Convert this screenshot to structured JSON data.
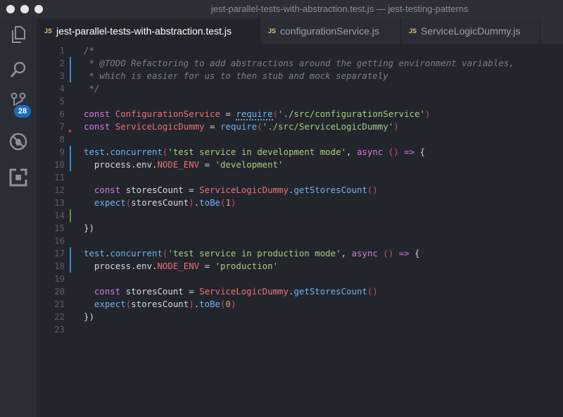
{
  "window": {
    "title": "jest-parallel-tests-with-abstraction.test.js — jest-testing-patterns"
  },
  "activity_bar": {
    "items": [
      {
        "name": "explorer-icon"
      },
      {
        "name": "search-icon"
      },
      {
        "name": "source-control-icon",
        "badge": "28"
      },
      {
        "name": "debug-icon"
      },
      {
        "name": "extensions-icon"
      }
    ]
  },
  "tabs": [
    {
      "icon": "JS",
      "label": "jest-parallel-tests-with-abstraction.test.js",
      "active": true
    },
    {
      "icon": "JS",
      "label": "configurationService.js",
      "active": false
    },
    {
      "icon": "JS",
      "label": "ServiceLogicDummy.js",
      "active": false
    }
  ],
  "editor": {
    "lines": [
      {
        "n": "1",
        "gutter": "",
        "tokens": [
          [
            "cm",
            "/*"
          ]
        ]
      },
      {
        "n": "2",
        "gutter": "mod",
        "tokens": [
          [
            "cm",
            " * @TODO Refactoring to add abstractions around the getting environment variables,"
          ]
        ]
      },
      {
        "n": "3",
        "gutter": "mod",
        "tokens": [
          [
            "cm",
            " * which is easier for us to then stub and mock separately"
          ]
        ]
      },
      {
        "n": "4",
        "gutter": "",
        "tokens": [
          [
            "cm",
            " */"
          ]
        ]
      },
      {
        "n": "5",
        "gutter": "",
        "tokens": []
      },
      {
        "n": "6",
        "gutter": "",
        "tokens": [
          [
            "kw",
            "const "
          ],
          [
            "cls",
            "ConfigurationService"
          ],
          [
            "txt",
            " = "
          ],
          [
            "fn",
            "require"
          ],
          [
            "par",
            "("
          ],
          [
            "str",
            "'./src/configurationService'"
          ],
          [
            "par",
            ")"
          ]
        ]
      },
      {
        "n": "7",
        "gutter": "del",
        "tokens": [
          [
            "kw",
            "const "
          ],
          [
            "cls",
            "ServiceLogicDummy"
          ],
          [
            "txt",
            " = "
          ],
          [
            "fn",
            "require"
          ],
          [
            "par",
            "("
          ],
          [
            "str",
            "'./src/ServiceLogicDummy'"
          ],
          [
            "par",
            ")"
          ]
        ]
      },
      {
        "n": "8",
        "gutter": "",
        "tokens": []
      },
      {
        "n": "9",
        "gutter": "mod",
        "tokens": [
          [
            "fn",
            "test"
          ],
          [
            "txt",
            "."
          ],
          [
            "fn",
            "concurrent"
          ],
          [
            "par",
            "("
          ],
          [
            "str",
            "'test service in development mode'"
          ],
          [
            "txt",
            ", "
          ],
          [
            "kw",
            "async "
          ],
          [
            "par",
            "()"
          ],
          [
            "kw",
            " => "
          ],
          [
            "txt",
            "{"
          ]
        ]
      },
      {
        "n": "10",
        "gutter": "mod",
        "tokens": [
          [
            "txt",
            "  process.env."
          ],
          [
            "prop",
            "NODE_ENV"
          ],
          [
            "txt",
            " = "
          ],
          [
            "str",
            "'development'"
          ]
        ]
      },
      {
        "n": "11",
        "gutter": "",
        "tokens": []
      },
      {
        "n": "12",
        "gutter": "",
        "tokens": [
          [
            "kw",
            "  const "
          ],
          [
            "var",
            "storesCount"
          ],
          [
            "txt",
            " = "
          ],
          [
            "cls",
            "ServiceLogicDummy"
          ],
          [
            "txt",
            "."
          ],
          [
            "fn",
            "getStoresCount"
          ],
          [
            "par",
            "()"
          ]
        ]
      },
      {
        "n": "13",
        "gutter": "",
        "tokens": [
          [
            "fn",
            "  expect"
          ],
          [
            "par",
            "("
          ],
          [
            "var",
            "storesCount"
          ],
          [
            "par",
            ")"
          ],
          [
            "txt",
            "."
          ],
          [
            "fn",
            "toBe"
          ],
          [
            "par",
            "("
          ],
          [
            "num",
            "1"
          ],
          [
            "par",
            ")"
          ]
        ]
      },
      {
        "n": "14",
        "gutter": "add",
        "tokens": []
      },
      {
        "n": "15",
        "gutter": "",
        "tokens": [
          [
            "txt",
            "})"
          ]
        ]
      },
      {
        "n": "16",
        "gutter": "",
        "tokens": []
      },
      {
        "n": "17",
        "gutter": "mod",
        "tokens": [
          [
            "fn",
            "test"
          ],
          [
            "txt",
            "."
          ],
          [
            "fn",
            "concurrent"
          ],
          [
            "par",
            "("
          ],
          [
            "str",
            "'test service in production mode'"
          ],
          [
            "txt",
            ", "
          ],
          [
            "kw",
            "async "
          ],
          [
            "par",
            "()"
          ],
          [
            "kw",
            " => "
          ],
          [
            "txt",
            "{"
          ]
        ]
      },
      {
        "n": "18",
        "gutter": "mod",
        "tokens": [
          [
            "txt",
            "  process.env."
          ],
          [
            "prop",
            "NODE_ENV"
          ],
          [
            "txt",
            " = "
          ],
          [
            "str",
            "'production'"
          ]
        ]
      },
      {
        "n": "19",
        "gutter": "",
        "tokens": []
      },
      {
        "n": "20",
        "gutter": "",
        "tokens": [
          [
            "kw",
            "  const "
          ],
          [
            "var",
            "storesCount"
          ],
          [
            "txt",
            " = "
          ],
          [
            "cls",
            "ServiceLogicDummy"
          ],
          [
            "txt",
            "."
          ],
          [
            "fn",
            "getStoresCount"
          ],
          [
            "par",
            "()"
          ]
        ]
      },
      {
        "n": "21",
        "gutter": "",
        "tokens": [
          [
            "fn",
            "  expect"
          ],
          [
            "par",
            "("
          ],
          [
            "var",
            "storesCount"
          ],
          [
            "par",
            ")"
          ],
          [
            "txt",
            "."
          ],
          [
            "fn",
            "toBe"
          ],
          [
            "par",
            "("
          ],
          [
            "num",
            "0"
          ],
          [
            "par",
            ")"
          ]
        ]
      },
      {
        "n": "22",
        "gutter": "",
        "tokens": [
          [
            "txt",
            "})"
          ]
        ]
      },
      {
        "n": "23",
        "gutter": "",
        "tokens": []
      }
    ]
  }
}
